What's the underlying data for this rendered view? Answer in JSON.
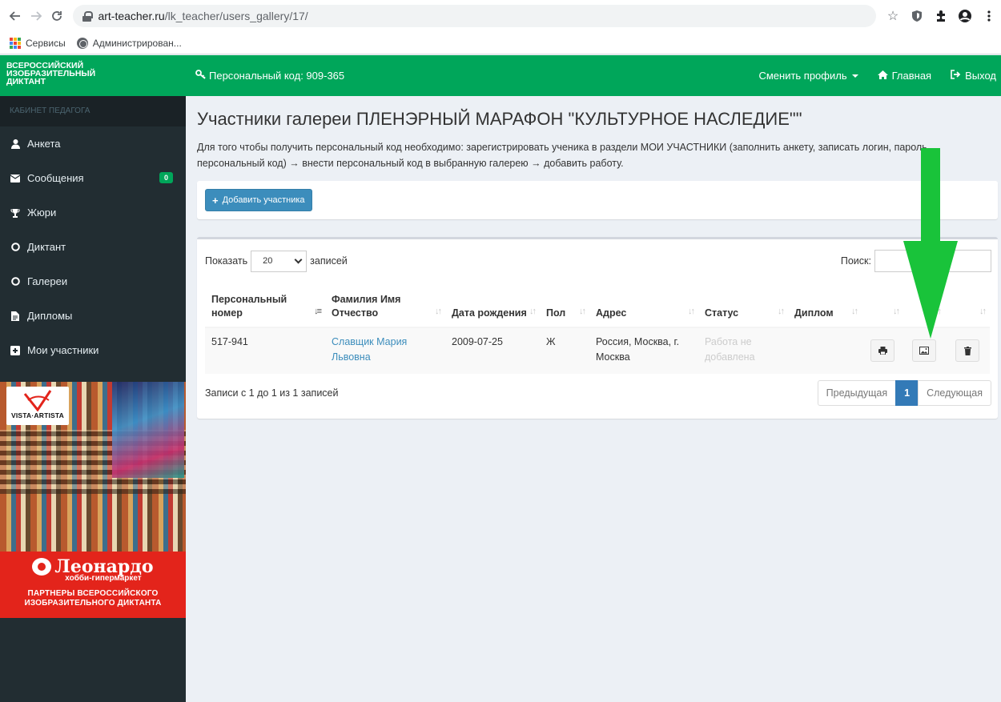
{
  "browser": {
    "url_host": "art-teacher.ru",
    "url_path": "/lk_teacher/users_gallery/17/",
    "bookmarks": [
      {
        "label": "Сервисы",
        "icon": "apps-grid-icon"
      },
      {
        "label": "Администрирован...",
        "icon": "globe-icon"
      }
    ],
    "icons": [
      "back-icon",
      "forward-icon",
      "reload-icon",
      "lock-icon",
      "star-icon",
      "shield-icon",
      "extensions-icon",
      "profile-icon",
      "menu-icon"
    ]
  },
  "sidebar": {
    "logo_lines": [
      "ВСЕРОССИЙСКИЙ",
      "ИЗОБРАЗИТЕЛЬНЫЙ",
      "ДИКТАНТ"
    ],
    "header": "КАБИНЕТ ПЕДАГОГА",
    "items": [
      {
        "label": "Анкета",
        "icon": "user-icon"
      },
      {
        "label": "Сообщения",
        "icon": "envelope-icon",
        "badge": "0"
      },
      {
        "label": "Жюри",
        "icon": "trophy-icon"
      },
      {
        "label": "Диктант",
        "icon": "circle-icon"
      },
      {
        "label": "Галереи",
        "icon": "circle-icon"
      },
      {
        "label": "Дипломы",
        "icon": "file-icon"
      },
      {
        "label": "Мои участники",
        "icon": "plus-square-icon"
      }
    ],
    "ad": {
      "vista_logo": "VISTA·ARTISTA",
      "brand_name": "Леонардо",
      "brand_sub": "хобби-гипермаркет",
      "partners_line1": "ПАРТНЕРЫ ВСЕРОССИЙСКОГО",
      "partners_line2": "ИЗОБРАЗИТЕЛЬНОГО ДИКТАНТА"
    }
  },
  "topbar": {
    "personal_code": "Персональный код: 909-365",
    "switch_profile": "Сменить профиль",
    "home": "Главная",
    "logout": "Выход"
  },
  "main": {
    "title": "Участники галереи ПЛЕНЭРНЫЙ МАРАФОН \"КУЛЬТУРНОЕ НАСЛЕДИЕ\"\"",
    "description": "Для того чтобы получить персональный код необходимо: зарегистрировать ученика в раздели МОИ УЧАСТНИКИ (заполнить анкету, записать логин, пароль, персональный код) → внести персональный код в выбранную галерею → добавить работу.",
    "add_button": "Добавить участника",
    "table": {
      "show_label": "Показать",
      "show_value": "20",
      "records_label": "записей",
      "search_label": "Поиск:",
      "columns": [
        "Персональный номер",
        "Фамилия Имя Отчество",
        "Дата рождения",
        "Пол",
        "Адрес",
        "Статус",
        "Диплом",
        "",
        "",
        ""
      ],
      "rows": [
        {
          "number": "517-941",
          "name": "Славщик Мария Львовна",
          "birth": "2009-07-25",
          "gender": "Ж",
          "address": "Россия, Москва, г. Москва",
          "status": "Работа не добавлена",
          "diploma": ""
        }
      ],
      "info": "Записи с 1 до 1 из 1 записей",
      "pager": {
        "prev": "Предыдущая",
        "current": "1",
        "next": "Следующая"
      }
    }
  },
  "colors": {
    "green": "#00a65a",
    "sidebar": "#222d32",
    "primary": "#3c8dbc",
    "arrow": "#19c33a"
  }
}
